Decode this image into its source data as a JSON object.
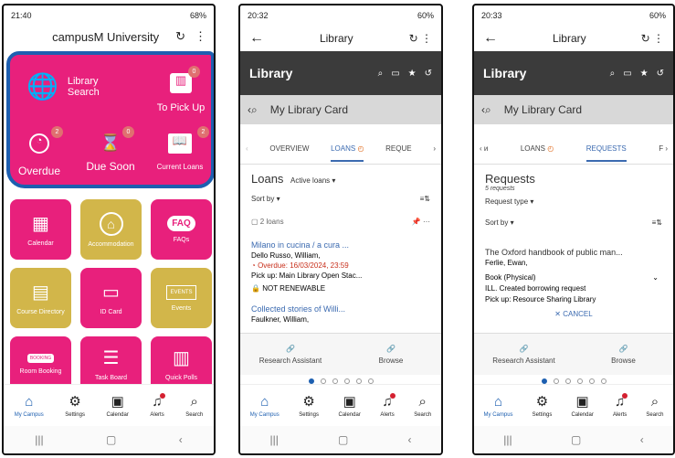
{
  "p1": {
    "status_time": "21:40",
    "status_battery": "68%",
    "header_title": "campusM University",
    "hero": {
      "library_search": "Library Search",
      "to_pick_up": "To Pick Up",
      "to_pick_up_badge": "0",
      "overdue": "Overdue",
      "overdue_badge": "2",
      "due_soon": "Due Soon",
      "due_soon_badge": "0",
      "current_loans": "Current Loans",
      "current_loans_badge": "2"
    },
    "tiles": [
      "Calendar",
      "Accommodation",
      "FAQs",
      "Course Directory",
      "ID Card",
      "Events",
      "Room Booking",
      "Task Board",
      "Quick Polls"
    ],
    "tile_faq_text": "FAQ",
    "tile_events_text": "EVENTS",
    "tile_booking_text": "BOOKING"
  },
  "nav": {
    "my_campus": "My Campus",
    "settings": "Settings",
    "calendar": "Calendar",
    "alerts": "Alerts",
    "search": "Search"
  },
  "p2": {
    "status_time": "20:32",
    "status_battery": "60%",
    "appbar_title": "Library",
    "library_label": "Library",
    "card_label": "My Library Card",
    "tab_overview": "OVERVIEW",
    "tab_loans": "LOANS",
    "tab_requests": "REQUE",
    "loans_title": "Loans",
    "loans_filter": "Active loans",
    "sort_by": "Sort by",
    "loans_count": "2 loans",
    "loan1_title": "Milano in cucina / a cura ...",
    "loan1_author": "Dello Russo, William,",
    "loan1_overdue": "Overdue: 16/03/2024, 23:59",
    "loan1_pickup": "Pick up: Main Library Open Stac...",
    "loan1_status": "NOT RENEWABLE",
    "loan2_title": "Collected stories of Willi...",
    "loan2_author": "Faulkner, William,",
    "research_assistant": "Research Assistant",
    "browse": "Browse"
  },
  "p3": {
    "status_time": "20:33",
    "status_battery": "60%",
    "appbar_title": "Library",
    "library_label": "Library",
    "card_label": "My Library Card",
    "tab_loans": "LOANS",
    "tab_requests": "REQUESTS",
    "requests_title": "Requests",
    "requests_count": "5 requests",
    "request_type": "Request type",
    "sort_by": "Sort by",
    "req_title": "The Oxford handbook of public man...",
    "req_author": "Ferlie, Ewan,",
    "req_format": "Book (Physical)",
    "req_status": "ILL. Created borrowing request",
    "req_pickup": "Pick up: Resource Sharing Library",
    "cancel": "CANCEL",
    "research_assistant": "Research Assistant",
    "browse": "Browse"
  }
}
